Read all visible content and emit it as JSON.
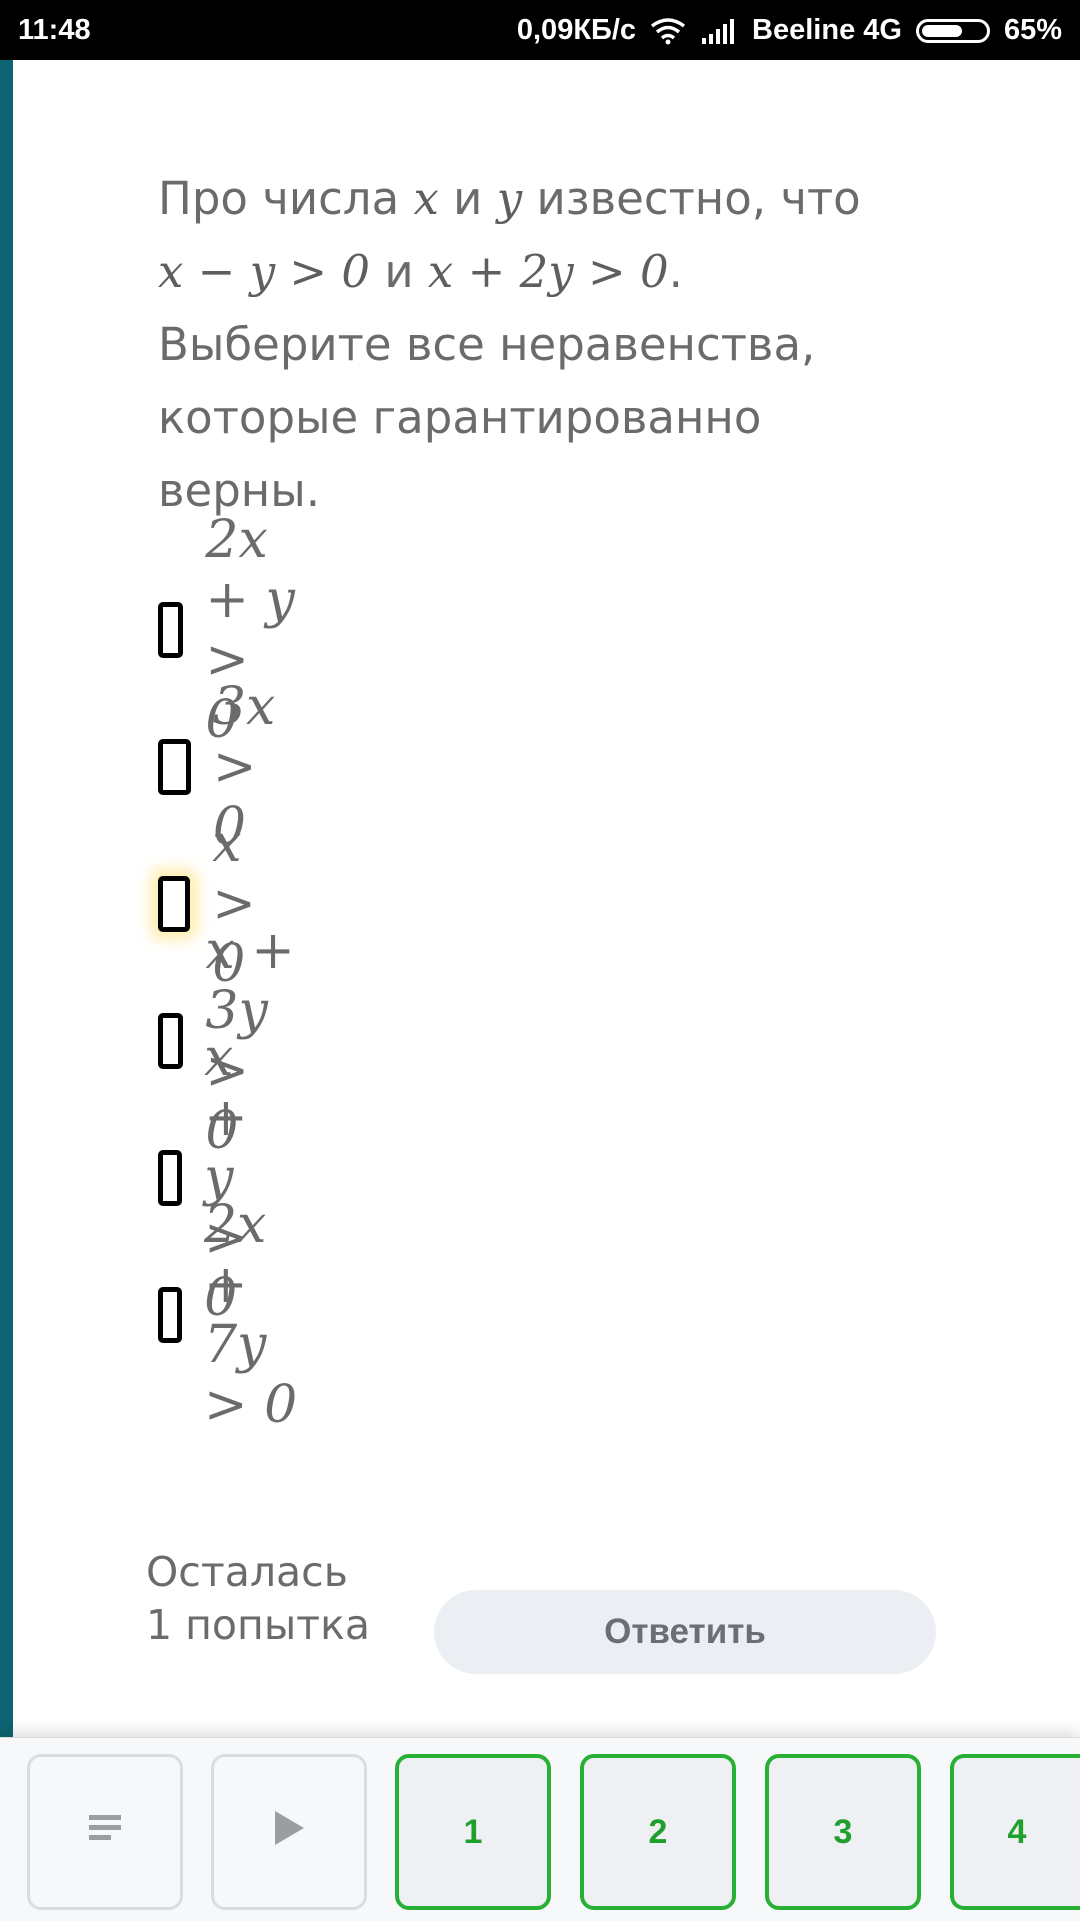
{
  "status_bar": {
    "time": "11:48",
    "speed": "0,09КБ/с",
    "carrier": "Beeline 4G",
    "battery": "65%",
    "battery_level": 0.65,
    "icons": [
      "wifi-icon",
      "signal-icon",
      "battery-icon"
    ]
  },
  "question": {
    "p1": "Про числа ",
    "var_x": "x",
    "p2": " и ",
    "var_y": "y",
    "p3": " известно, что",
    "cond1": "x − y > 0",
    "p4": " и ",
    "cond2": "x + 2y > 0",
    "p5": ".",
    "p6": "Выберите все неравенства, которые гарантированно верны."
  },
  "options": [
    {
      "label": "2x + y > 0",
      "checked": false
    },
    {
      "label": "3x > 0",
      "checked": false
    },
    {
      "label": "x > 0",
      "checked": false
    },
    {
      "label": "x + 3y > 0",
      "checked": false
    },
    {
      "label": "x + y > 0",
      "checked": false
    },
    {
      "label": "2x + 7y > 0",
      "checked": false
    }
  ],
  "attempts_text": "Осталась 1 попытка",
  "answer_button": "Ответить",
  "bottom_nav": {
    "menu_icon": "menu-icon",
    "play_icon": "play-icon",
    "steps": [
      "1",
      "2",
      "3",
      "4"
    ]
  },
  "colors": {
    "accent_stripe": "#0e6472",
    "step_border": "#28b035",
    "step_text": "#1f9f2c",
    "button_bg": "#ebeef2"
  }
}
